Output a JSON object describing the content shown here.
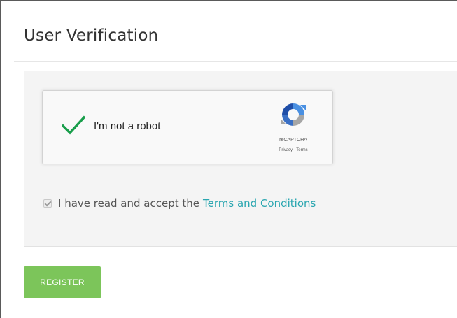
{
  "page": {
    "title": "User Verification"
  },
  "captcha": {
    "label": "I'm not a robot",
    "checked": true,
    "brand": "reCAPTCHA",
    "privacy_link": "Privacy",
    "separator": " - ",
    "terms_link": "Terms"
  },
  "terms": {
    "text": "I have read and accept the",
    "link_text": "Terms and Conditions",
    "checked": true
  },
  "actions": {
    "register_label": "REGISTER"
  },
  "colors": {
    "accent": "#7cc55a",
    "link": "#2aa6b0",
    "check": "#199e4b",
    "panel_bg": "#f4f4f4"
  },
  "icons": {
    "captcha_check": "check-icon",
    "recaptcha": "recaptcha-logo-icon",
    "terms_checkbox": "checkbox-checked-icon"
  }
}
